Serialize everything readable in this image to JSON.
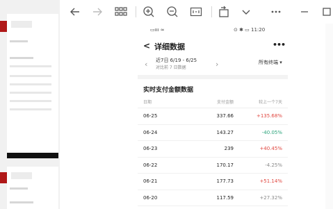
{
  "toolbar": {
    "buttons": [
      "back-icon",
      "forward-icon",
      "grid-icon",
      "zoom-in-icon",
      "zoom-out-icon",
      "fit-icon",
      "rotate-icon",
      "chevron-down-icon",
      "more-icon",
      "minimize-icon",
      "maximize-icon"
    ]
  },
  "status_bar": {
    "left": "▭ııı ≈",
    "right": "⊙ ✱ ▭ 11:20"
  },
  "header": {
    "back": "<",
    "title": "详细数据",
    "more": "•••"
  },
  "range": {
    "main": "近7日 6/19 - 6/25",
    "sub": "对比前 7 日数据",
    "terminal": "所有终端 ▾",
    "prev": "‹",
    "next": "›"
  },
  "section": {
    "title": "实时支付金额数据"
  },
  "table": {
    "columns": [
      "日期",
      "支付金额",
      "较上一个7天"
    ],
    "rows": [
      {
        "date": "06-25",
        "amount": "337.66",
        "change": "+135.68%",
        "dir": "up"
      },
      {
        "date": "06-24",
        "amount": "143.27",
        "change": "-40.05%",
        "dir": "down"
      },
      {
        "date": "06-23",
        "amount": "239",
        "change": "+40.45%",
        "dir": "up"
      },
      {
        "date": "06-22",
        "amount": "170.17",
        "change": "-4.25%",
        "dir": "flat"
      },
      {
        "date": "06-21",
        "amount": "177.73",
        "change": "+51.14%",
        "dir": "up"
      },
      {
        "date": "06-20",
        "amount": "117.59",
        "change": "+27.32%",
        "dir": "flat"
      }
    ]
  },
  "colors": {
    "up": "#e0463f",
    "down": "#2aa37a",
    "flat": "#888888"
  }
}
